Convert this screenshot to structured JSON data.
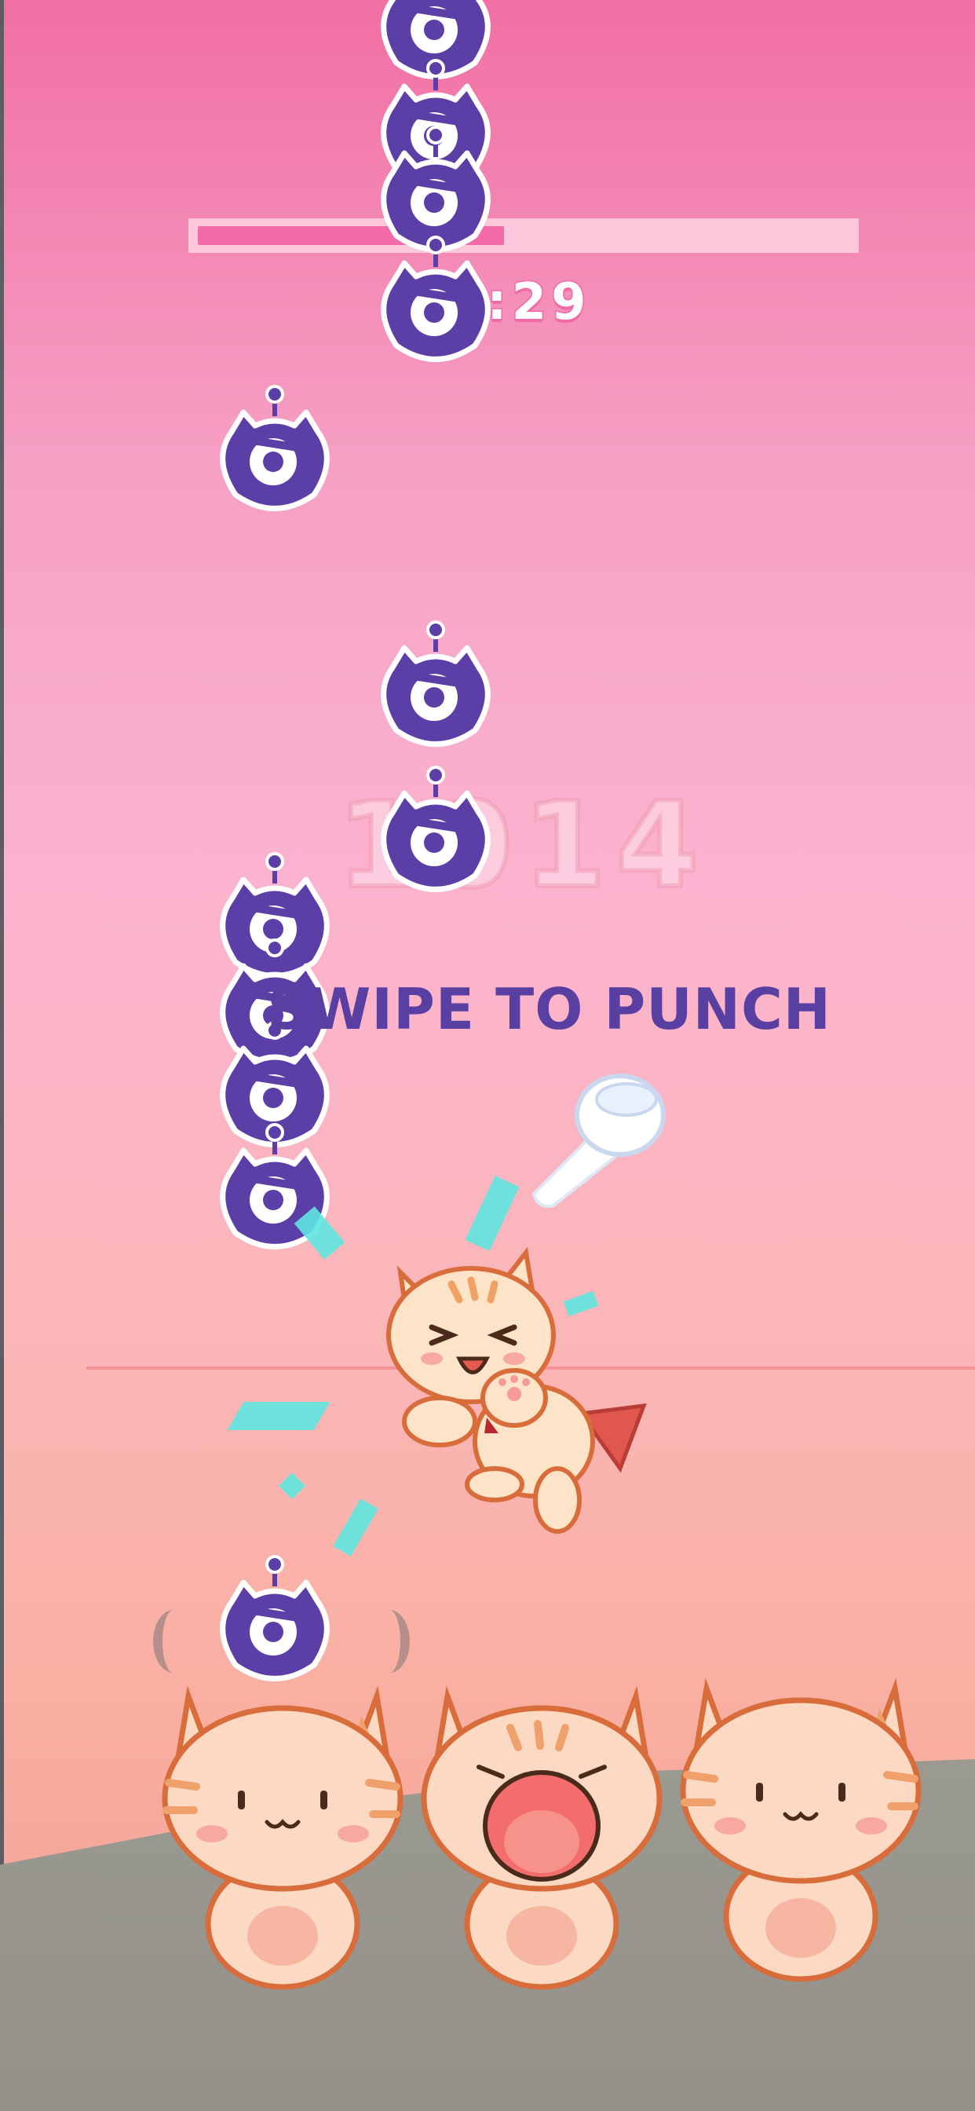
{
  "hud": {
    "progress_fraction": 0.47,
    "timer": ":29",
    "score": "1014"
  },
  "instruction": "SWIPE TO PUNCH",
  "icons": {
    "alien": "purple-one-eyed-alien-icon",
    "hero": "punching-cat-hero",
    "pointer": "pointing-hand-icon",
    "crowd": "cat-spectator"
  },
  "colors": {
    "alien": "#5b3fa6",
    "progress": "#f36aa8",
    "instruction": "#5a3fa2",
    "cat_body": "#fde3c8",
    "cat_outline": "#d86c3a"
  }
}
